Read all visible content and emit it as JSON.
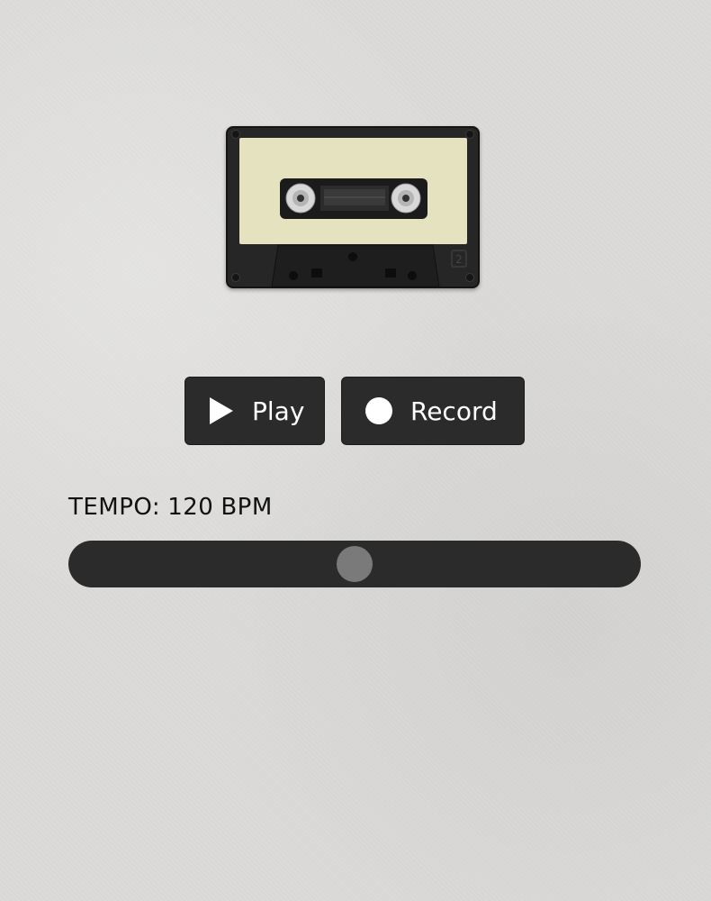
{
  "player": {
    "play_label": "Play",
    "play_icon": "play-icon",
    "record_label": "Record",
    "record_icon": "record-icon"
  },
  "tempo": {
    "label": "TEMPO:",
    "value": "120",
    "unit": "BPM",
    "slider_fraction": 0.5
  },
  "cassette": {
    "side_label": "2"
  },
  "colors": {
    "button_bg": "#2b2b2b",
    "slider_track": "#2b2b2b",
    "slider_thumb": "#7a7a7a",
    "cassette_label": "#e5e2bf"
  }
}
